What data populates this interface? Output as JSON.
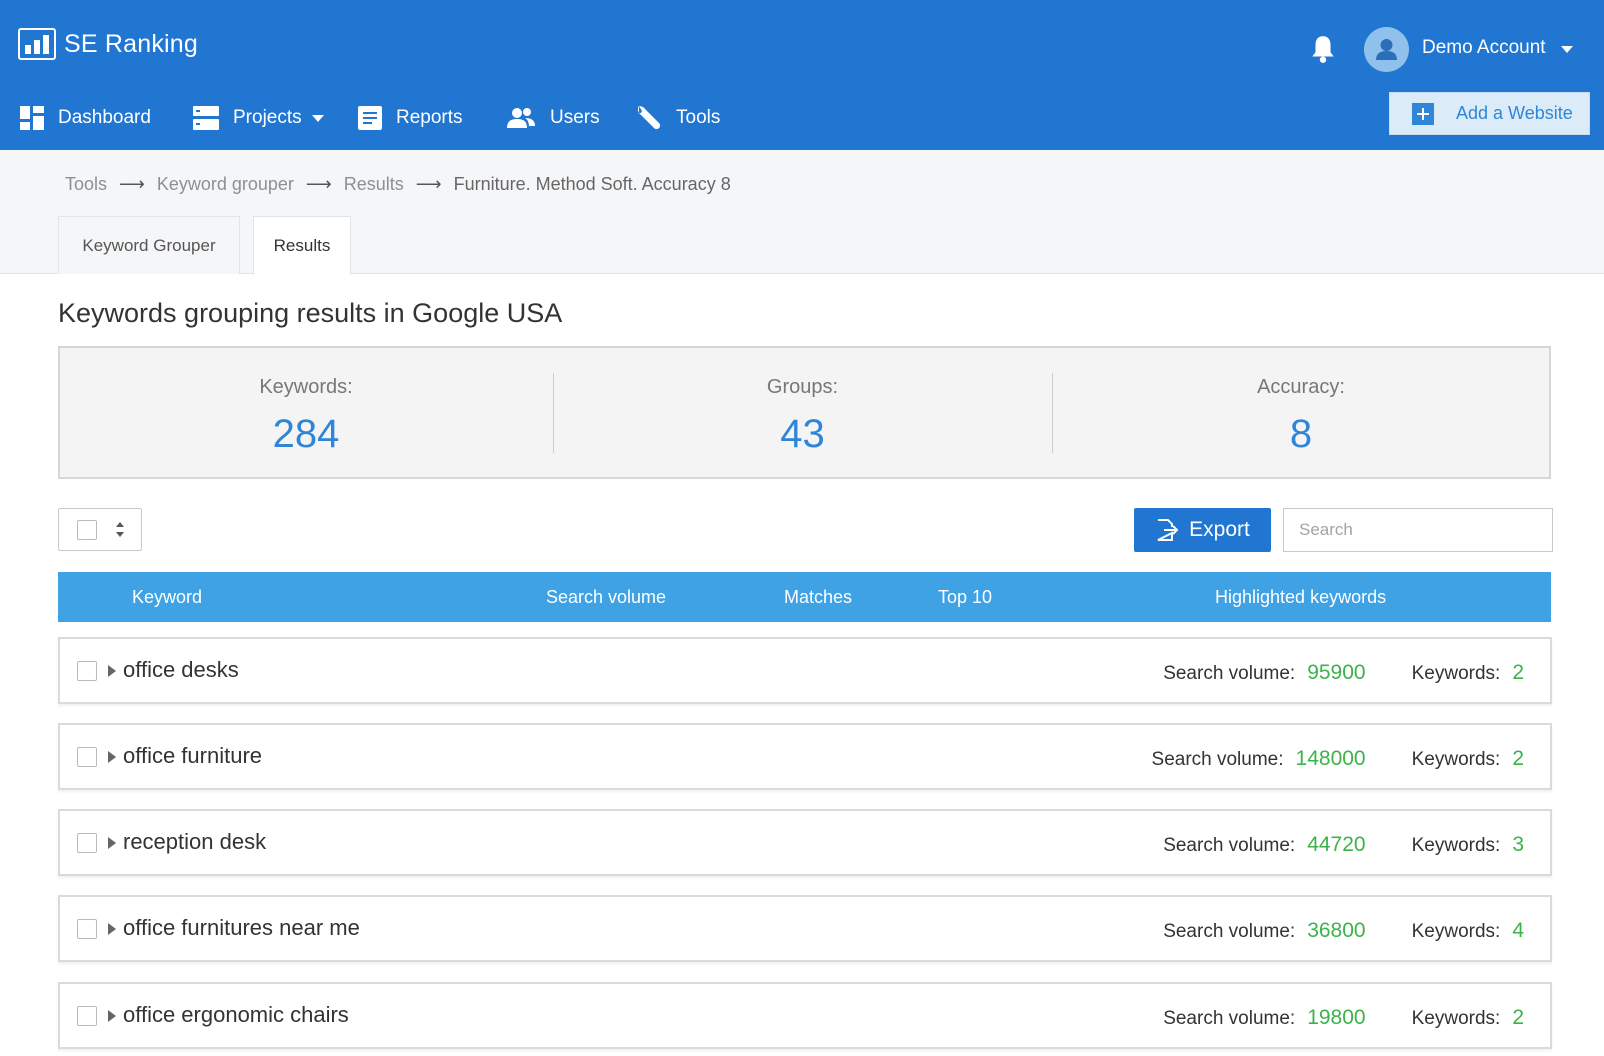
{
  "app": {
    "name": "SE Ranking"
  },
  "account": {
    "name": "Demo Account"
  },
  "nav": {
    "items": [
      {
        "label": "Dashboard",
        "icon": "dashboard-icon"
      },
      {
        "label": "Projects",
        "icon": "projects-icon"
      },
      {
        "label": "Reports",
        "icon": "reports-icon"
      },
      {
        "label": "Users",
        "icon": "users-icon"
      },
      {
        "label": "Tools",
        "icon": "wrench-icon"
      }
    ],
    "add_website": "Add a Website"
  },
  "breadcrumb": {
    "items": [
      "Tools",
      "Keyword grouper",
      "Results"
    ],
    "current": "Furniture. Method Soft. Accuracy 8",
    "separator": "⟶"
  },
  "tabs": [
    {
      "label": "Keyword Grouper",
      "active": false
    },
    {
      "label": "Results",
      "active": true
    }
  ],
  "page_title": "Keywords grouping results in Google USA",
  "stats": {
    "keywords": {
      "label": "Keywords:",
      "value": "284"
    },
    "groups": {
      "label": "Groups:",
      "value": "43"
    },
    "accuracy": {
      "label": "Accuracy:",
      "value": "8"
    }
  },
  "toolbar": {
    "export_label": "Export",
    "search_placeholder": "Search"
  },
  "table": {
    "columns": [
      "Keyword",
      "Search volume",
      "Matches",
      "Top 10",
      "Highlighted keywords"
    ],
    "volume_label": "Search volume:",
    "keywords_label": "Keywords:",
    "rows": [
      {
        "name": "office desks",
        "volume": "95900",
        "keywords": "2"
      },
      {
        "name": "office furniture",
        "volume": "148000",
        "keywords": "2"
      },
      {
        "name": "reception desk",
        "volume": "44720",
        "keywords": "3"
      },
      {
        "name": "office furnitures near me",
        "volume": "36800",
        "keywords": "4"
      },
      {
        "name": "office ergonomic chairs",
        "volume": "19800",
        "keywords": "2"
      }
    ]
  },
  "colors": {
    "header_bg": "#2176d2",
    "table_header_bg": "#3ea2e4",
    "accent_blue": "#2f86d6",
    "value_green": "#3cb34a"
  }
}
